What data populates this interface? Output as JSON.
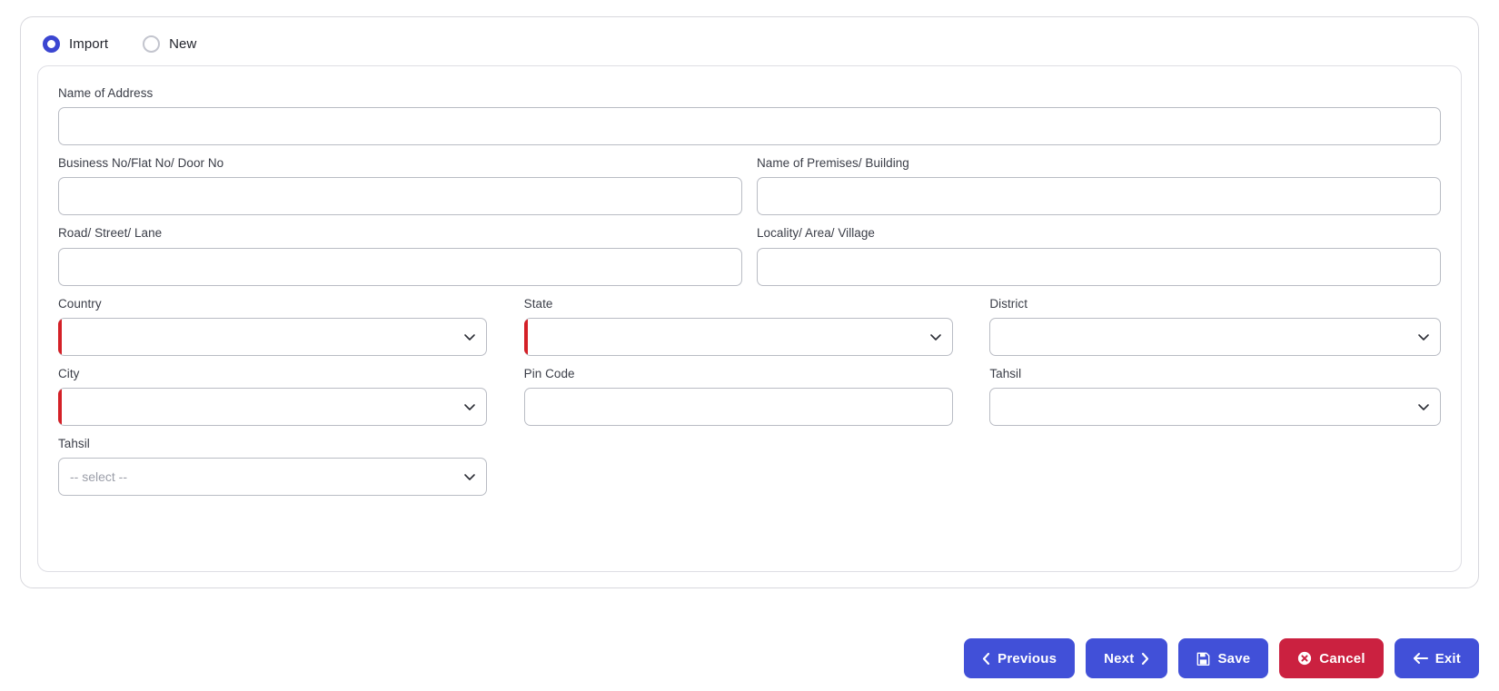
{
  "mode_selector": {
    "options": [
      {
        "label": "Import",
        "selected": true
      },
      {
        "label": "New",
        "selected": false
      }
    ]
  },
  "form": {
    "fields": [
      {
        "name": "name-of-address",
        "label": "Name of Address",
        "type": "text",
        "value": "",
        "placeholder": "",
        "invalid": false
      },
      {
        "name": "business-no",
        "label": "Business No/Flat No/ Door No",
        "type": "text",
        "value": "",
        "placeholder": "",
        "invalid": false
      },
      {
        "name": "name-of-premises",
        "label": "Name of Premises/ Building",
        "type": "text",
        "value": "",
        "placeholder": "",
        "invalid": false
      },
      {
        "name": "road-street-lane",
        "label": "Road/ Street/ Lane",
        "type": "text",
        "value": "",
        "placeholder": "",
        "invalid": false
      },
      {
        "name": "locality-area-village",
        "label": "Locality/ Area/ Village",
        "type": "text",
        "value": "",
        "placeholder": "",
        "invalid": false
      },
      {
        "name": "country",
        "label": "Country",
        "type": "select",
        "value": "",
        "placeholder": "",
        "invalid": true
      },
      {
        "name": "state",
        "label": "State",
        "type": "select",
        "value": "",
        "placeholder": "",
        "invalid": true
      },
      {
        "name": "district",
        "label": "District",
        "type": "select",
        "value": "",
        "placeholder": "",
        "invalid": false
      },
      {
        "name": "city",
        "label": "City",
        "type": "select",
        "value": "",
        "placeholder": "",
        "invalid": true
      },
      {
        "name": "pin-code",
        "label": "Pin Code",
        "type": "text",
        "value": "",
        "placeholder": "",
        "invalid": false
      },
      {
        "name": "tahsil-right",
        "label": "Tahsil",
        "type": "select",
        "value": "",
        "placeholder": "",
        "invalid": false
      },
      {
        "name": "tahsil-bottom",
        "label": "Tahsil",
        "type": "select",
        "value": "",
        "placeholder": "-- select --",
        "invalid": false
      }
    ],
    "labels": {
      "name_of_address": "Name of Address",
      "business_no": "Business No/Flat No/ Door No",
      "name_of_premises": "Name of Premises/ Building",
      "road_street_lane": "Road/ Street/ Lane",
      "locality_area_village": "Locality/ Area/ Village",
      "country": "Country",
      "state": "State",
      "district": "District",
      "city": "City",
      "pin_code": "Pin Code",
      "tahsil_right": "Tahsil",
      "tahsil_bottom": "Tahsil"
    },
    "placeholders": {
      "tahsil_bottom": "-- select --"
    }
  },
  "footer": {
    "buttons": [
      {
        "name": "previous-button",
        "label": "Previous",
        "icon": "chevron-left-icon",
        "icon_side": "left",
        "style": "primary"
      },
      {
        "name": "next-button",
        "label": "Next",
        "icon": "chevron-right-icon",
        "icon_side": "right",
        "style": "primary"
      },
      {
        "name": "save-button",
        "label": "Save",
        "icon": "floppy-disk-icon",
        "icon_side": "left",
        "style": "primary"
      },
      {
        "name": "cancel-button",
        "label": "Cancel",
        "icon": "circle-x-icon",
        "icon_side": "left",
        "style": "danger"
      },
      {
        "name": "exit-button",
        "label": "Exit",
        "icon": "arrow-left-icon",
        "icon_side": "left",
        "style": "primary"
      }
    ],
    "previous_label": "Previous",
    "next_label": "Next",
    "save_label": "Save",
    "cancel_label": "Cancel",
    "exit_label": "Exit"
  },
  "colors": {
    "primary": "#4150d8",
    "danger": "#cb2140",
    "invalid_accent": "#d42027",
    "radio_selected": "#3b46d1",
    "border": "#b9bcc4"
  }
}
